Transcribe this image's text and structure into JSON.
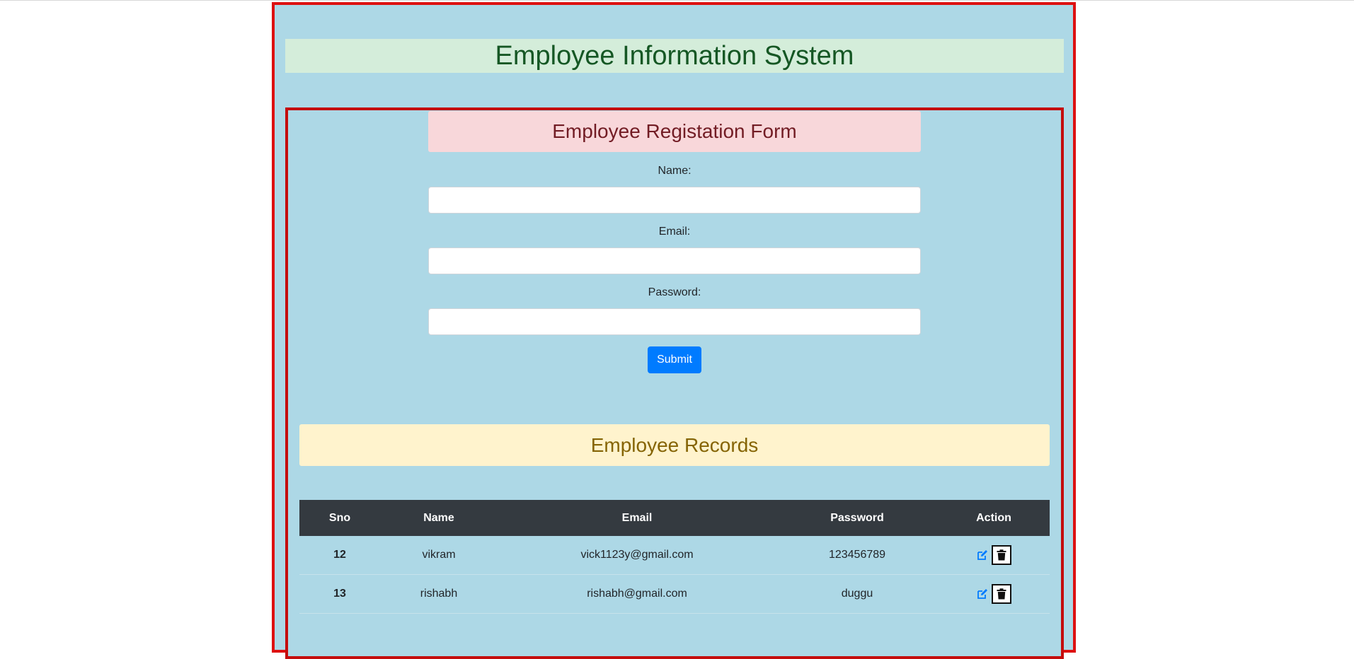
{
  "page": {
    "title": "Employee Information System"
  },
  "form": {
    "title": "Employee Registation Form",
    "name_label": "Name:",
    "name_value": "",
    "email_label": "Email:",
    "email_value": "",
    "password_label": "Password:",
    "password_value": "",
    "submit_label": "Submit"
  },
  "records": {
    "title": "Employee Records",
    "columns": [
      "Sno",
      "Name",
      "Email",
      "Password",
      "Action"
    ],
    "rows": [
      {
        "sno": "12",
        "name": "vikram",
        "email": "vick1123y@gmail.com",
        "password": "123456789"
      },
      {
        "sno": "13",
        "name": "rishabh",
        "email": "rishabh@gmail.com",
        "password": "duggu"
      }
    ]
  },
  "icons": {
    "edit": "edit-icon",
    "delete": "trash-icon"
  },
  "colors": {
    "page_background": "#add8e6",
    "outer_border": "#dd1111",
    "title_banner_bg": "#d4edda",
    "title_banner_text": "#155724",
    "form_header_bg": "#f8d7da",
    "form_header_text": "#721c24",
    "records_header_bg": "#fff3cd",
    "records_header_text": "#856404",
    "table_header_bg": "#343a40",
    "submit_button": "#007bff",
    "edit_icon": "#007bff"
  }
}
